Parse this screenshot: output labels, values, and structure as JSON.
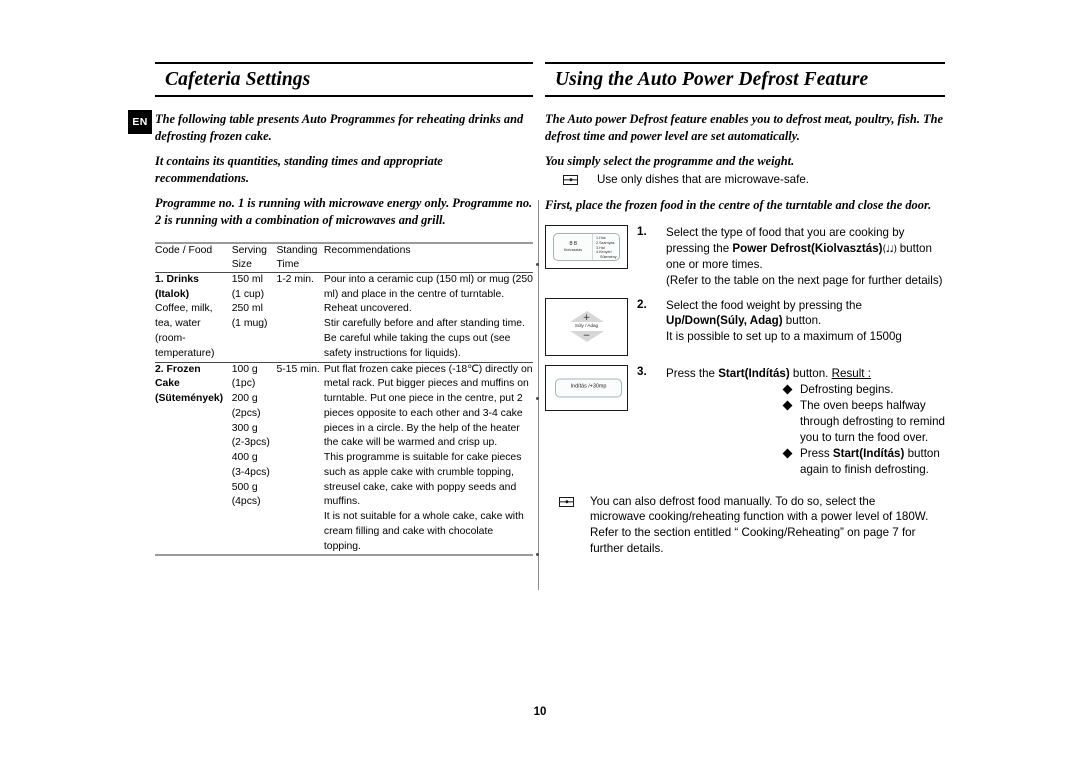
{
  "language_tab": "EN",
  "page_number": "10",
  "left": {
    "heading": "Cafeteria Settings",
    "leads": [
      "The following table presents Auto Programmes for reheating drinks and defrosting frozen cake.",
      "It contains its quantities, standing times and appropriate recommendations.",
      "Programme no. 1 is running with microwave energy only. Programme no. 2 is running with a combination of microwaves and grill."
    ],
    "table": {
      "headers": [
        "Code / Food",
        "Serving Size",
        "Standing Time",
        "Recommendations"
      ],
      "header_lines": [
        [
          "Code / Food"
        ],
        [
          "Serving",
          "Size"
        ],
        [
          "Standing",
          "Time"
        ],
        [
          "Recommendations"
        ]
      ],
      "rows": [
        {
          "code_lines": [
            "1. Drinks",
            "(Italok)",
            "Coffee, milk,",
            "tea, water",
            "(room-",
            "temperature)"
          ],
          "code_bold": [
            true,
            true,
            false,
            false,
            false,
            false
          ],
          "size_lines": [
            "150 ml",
            "(1 cup)",
            "250 ml",
            "(1 mug)"
          ],
          "time_lines": [
            "1-2 min."
          ],
          "rec_lines": [
            "Pour into a ceramic cup (150 ml) or mug (250",
            "ml) and place in the centre of turntable.",
            "Reheat uncovered.",
            "Stir carefully before and after standing time.",
            "Be careful while taking the cups out (see",
            "safety instructions for liquids)."
          ]
        },
        {
          "code_lines": [
            "2. Frozen",
            "Cake",
            "(Sütemények)"
          ],
          "code_bold": [
            true,
            true,
            true
          ],
          "size_lines": [
            "100 g",
            "(1pc)",
            "200 g",
            "(2pcs)",
            "300 g",
            "(2-3pcs)",
            "400 g",
            "(3-4pcs)",
            "500 g",
            "(4pcs)"
          ],
          "time_lines": [
            "5-15 min."
          ],
          "rec_lines": [
            "Put flat frozen cake pieces (-18℃) directly on",
            "metal rack. Put bigger pieces and muffins on",
            "turntable. Put one piece in the centre, put 2",
            "pieces opposite to each other and 3-4 cake",
            "pieces in a circle. By the help of the heater",
            "the cake will be warmed and crisp up.",
            "This programme is suitable for cake pieces",
            "such as apple cake with crumble topping,",
            "streusel cake, cake with poppy seeds and",
            "muffins.",
            "It is not suitable for a whole cake, cake with",
            "cream filling and cake with chocolate",
            "topping."
          ]
        }
      ]
    }
  },
  "right": {
    "heading": "Using the Auto Power Defrost Feature",
    "lead1": "The Auto power Defrost feature enables you to defrost meat, poultry, fish. The defrost time and power level are set automatically.",
    "lead2": "You simply select the programme and the weight.",
    "note_microwave_safe": "Use only dishes that are microwave-safe.",
    "lead3": "First, place the frozen food in the centre of the turntable and close the door.",
    "steps": [
      {
        "number": "1.",
        "panel": {
          "kind": "power-defrost-key",
          "left_glyph": "8 8",
          "left_label": "Kiolvasztás",
          "items": [
            "1.Hús",
            "2.Szárnyas",
            "3.Hal",
            "4.Kenyér/",
            "Sütemény"
          ]
        },
        "text_pre": "Select the type of food that you are cooking by pressing the ",
        "text_bold": "Power Defrost(Kiolvasztás)",
        "glyph": "(♩♩)",
        "text_post": " button one or more times.",
        "text_extra": "(Refer to the table on the next page for further details)"
      },
      {
        "number": "2.",
        "panel": {
          "kind": "up-down-key",
          "plus": "+",
          "minus": "−",
          "label": "Súly / Adag"
        },
        "text_pre": "Select the food weight by pressing the ",
        "text_bold": "Up/Down(Súly, Adag)",
        "text_post": " button.",
        "text_extra": "It is possible to set up to a maximum of 1500g"
      },
      {
        "number": "3.",
        "panel": {
          "kind": "start-key",
          "label": "Indítás /+30mp"
        },
        "text_pre": "Press the ",
        "text_bold": "Start(Indítás)",
        "text_post": " button.",
        "result_label": "Result :",
        "results": [
          {
            "pre": "Defrosting begins.",
            "bold": "",
            "post": ""
          },
          {
            "pre": "The oven beeps halfway through defrosting to remind you to turn the food over.",
            "bold": "",
            "post": ""
          },
          {
            "pre": "Press ",
            "bold": "Start(Indítás)",
            "post": " button again to finish defrosting."
          }
        ]
      }
    ],
    "manual_note": "You can also defrost food manually. To do so, select the microwave cooking/reheating function with a power level of 180W. Refer to the section entitled “ Cooking/Reheating” on page 7 for further details."
  }
}
